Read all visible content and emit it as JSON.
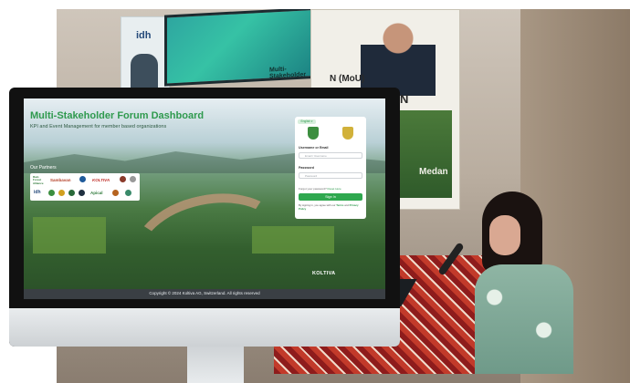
{
  "background": {
    "banner_left_logo": "idh",
    "banner_right_text_1": "N (MoU)",
    "banner_right_text_2": "ANUTAN",
    "banner_right_text_3": "Medan",
    "projector_text": "Multi-Stakeholder"
  },
  "dashboard": {
    "title": "Multi-Stakeholder Forum Dashboard",
    "subtitle": "KPI and Event Management for member based organizations",
    "partners_label": "Our Partners",
    "partners": [
      "Rain Forest Alliance",
      "Sambavan",
      "",
      "KOLTIVA",
      "",
      "",
      "idh",
      "",
      "",
      "",
      "",
      "Apical",
      "",
      ""
    ],
    "brand": "KOLTIVA",
    "copyright": "Copyright © 2024 Koltiva AG, Switzerland. All rights reserved"
  },
  "login": {
    "language": "English ▾",
    "username_label": "Username or Email",
    "username_placeholder": "Email / Username",
    "password_label": "Password",
    "password_placeholder": "Password",
    "forgot_text": "Forgot your password?",
    "forgot_link": "Reset Here",
    "signin_label": "Sign In",
    "terms_text": "By signing in, you agree with our",
    "terms_link": "Terms",
    "and_text": "and",
    "privacy_link": "Privacy Policy"
  }
}
